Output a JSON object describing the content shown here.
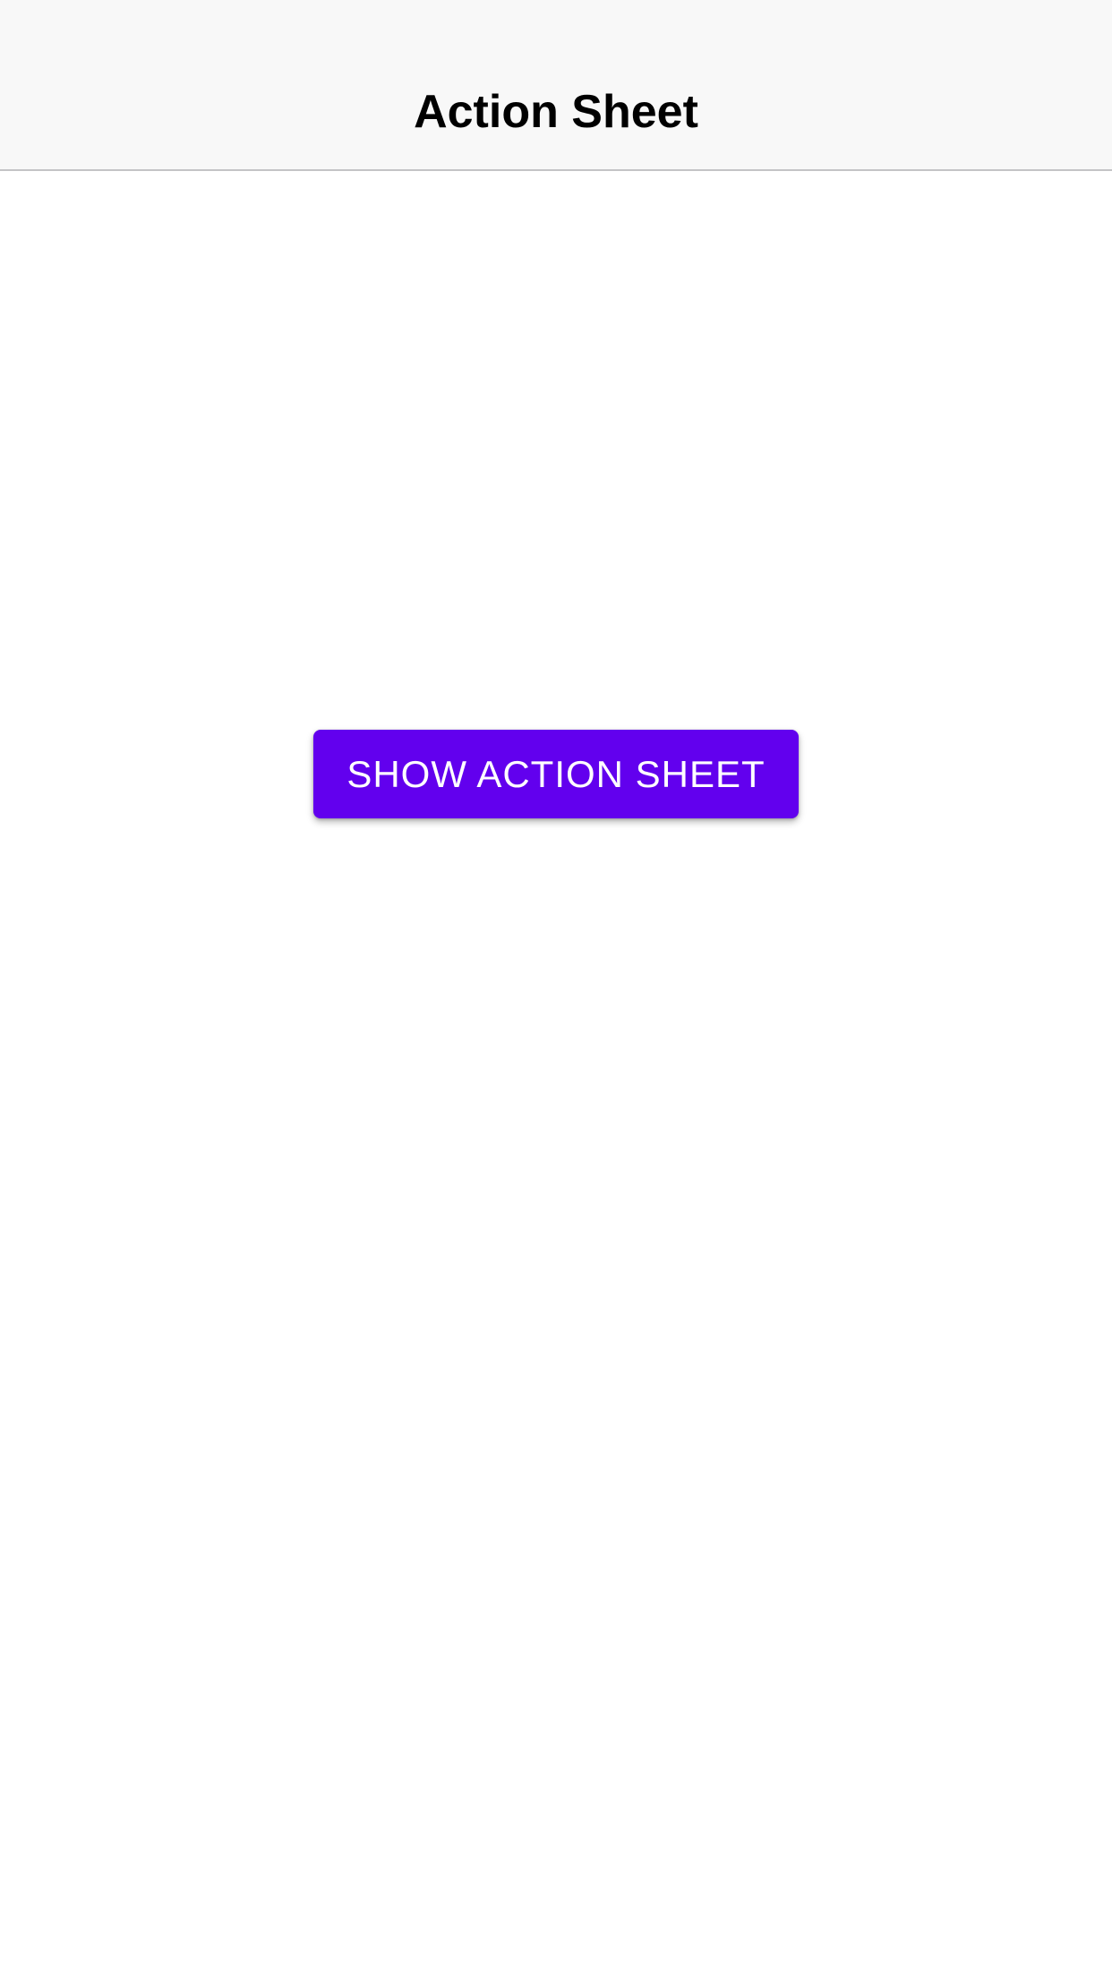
{
  "header": {
    "title": "Action Sheet"
  },
  "main": {
    "show_button_label": "SHOW ACTION SHEET"
  },
  "colors": {
    "nav_background": "#f8f8f8",
    "nav_border": "#c4c4c6",
    "button_background": "#6200ee",
    "button_text": "#ffffff",
    "page_background": "#ffffff"
  }
}
